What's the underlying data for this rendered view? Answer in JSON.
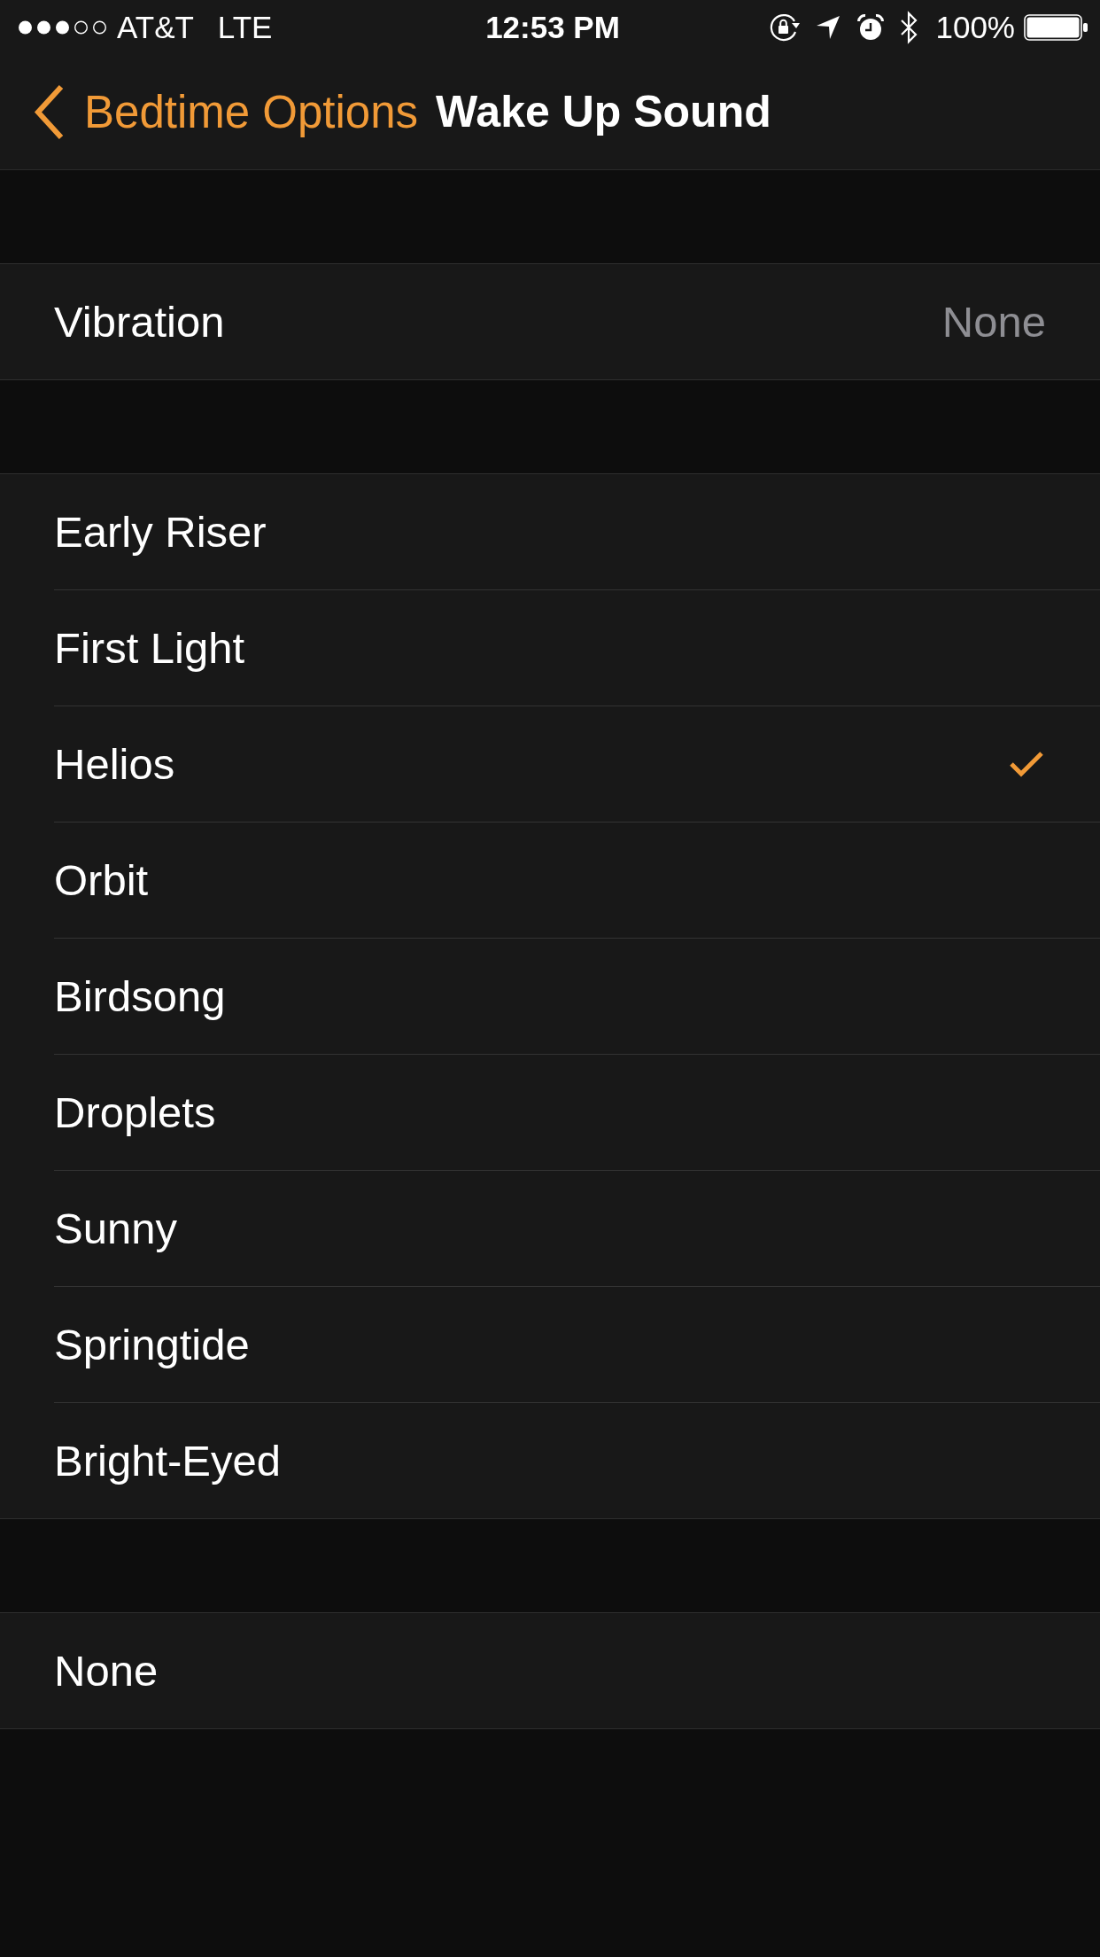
{
  "status_bar": {
    "carrier": "AT&T",
    "network": "LTE",
    "time": "12:53 PM",
    "battery": "100%"
  },
  "nav_bar": {
    "back_label": "Bedtime Options",
    "title": "Wake Up Sound"
  },
  "sections": [
    {
      "rows": [
        {
          "kind": "detail",
          "label": "Vibration",
          "value": "None"
        }
      ]
    },
    {
      "rows": [
        {
          "kind": "choice",
          "label": "Early Riser",
          "selected": false
        },
        {
          "kind": "choice",
          "label": "First Light",
          "selected": false
        },
        {
          "kind": "choice",
          "label": "Helios",
          "selected": true
        },
        {
          "kind": "choice",
          "label": "Orbit",
          "selected": false
        },
        {
          "kind": "choice",
          "label": "Birdsong",
          "selected": false
        },
        {
          "kind": "choice",
          "label": "Droplets",
          "selected": false
        },
        {
          "kind": "choice",
          "label": "Sunny",
          "selected": false
        },
        {
          "kind": "choice",
          "label": "Springtide",
          "selected": false
        },
        {
          "kind": "choice",
          "label": "Bright-Eyed",
          "selected": false
        }
      ]
    },
    {
      "rows": [
        {
          "kind": "choice",
          "label": "None",
          "selected": false
        }
      ]
    }
  ]
}
